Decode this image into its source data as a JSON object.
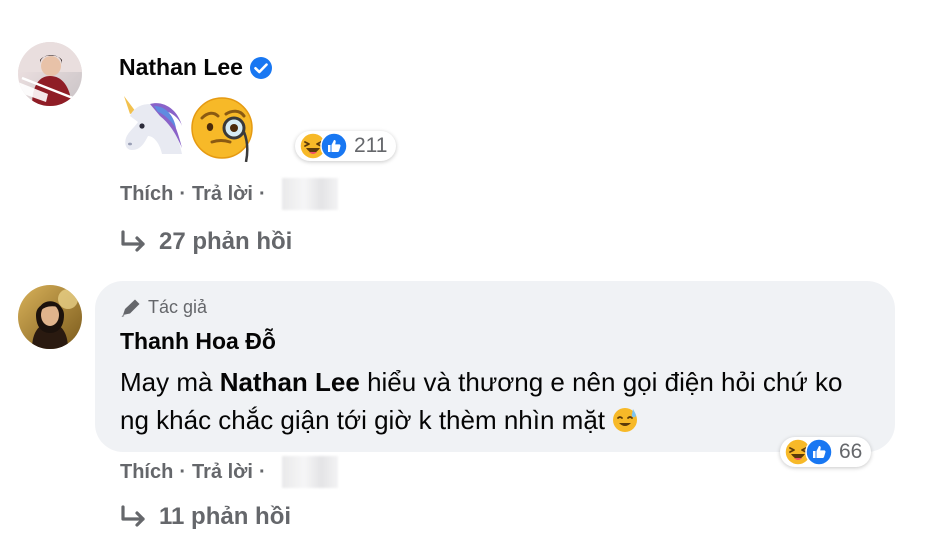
{
  "comments": [
    {
      "author": "Nathan Lee",
      "verified": true,
      "content_stickers": [
        "unicorn-sticker",
        "monocle-face-sticker"
      ],
      "reactions": {
        "icons": [
          "haha-icon",
          "like-icon"
        ],
        "count": "211"
      },
      "actions": {
        "like": "Thích",
        "reply": "Trả lời",
        "separator": "·"
      },
      "replies_label": "27 phản hồi"
    },
    {
      "badge": "Tác giả",
      "author": "Thanh Hoa Đỗ",
      "text_before": "May mà ",
      "mention": "Nathan Lee",
      "text_after": " hiểu và thương e nên gọi điện hỏi chứ ko ng khác chắc giận tới giờ k thèm nhìn mặt",
      "trailing_emoji": "sweat-smile-emoji",
      "reactions": {
        "icons": [
          "haha-icon",
          "like-icon"
        ],
        "count": "66"
      },
      "actions": {
        "like": "Thích",
        "reply": "Trả lời",
        "separator": "·"
      },
      "replies_label": "11 phản hồi"
    }
  ],
  "colors": {
    "text_primary": "#050505",
    "text_secondary": "#65676b",
    "bubble_background": "#f0f2f5",
    "verified_blue": "#1877f2",
    "haha_yellow": "#f7b928"
  }
}
